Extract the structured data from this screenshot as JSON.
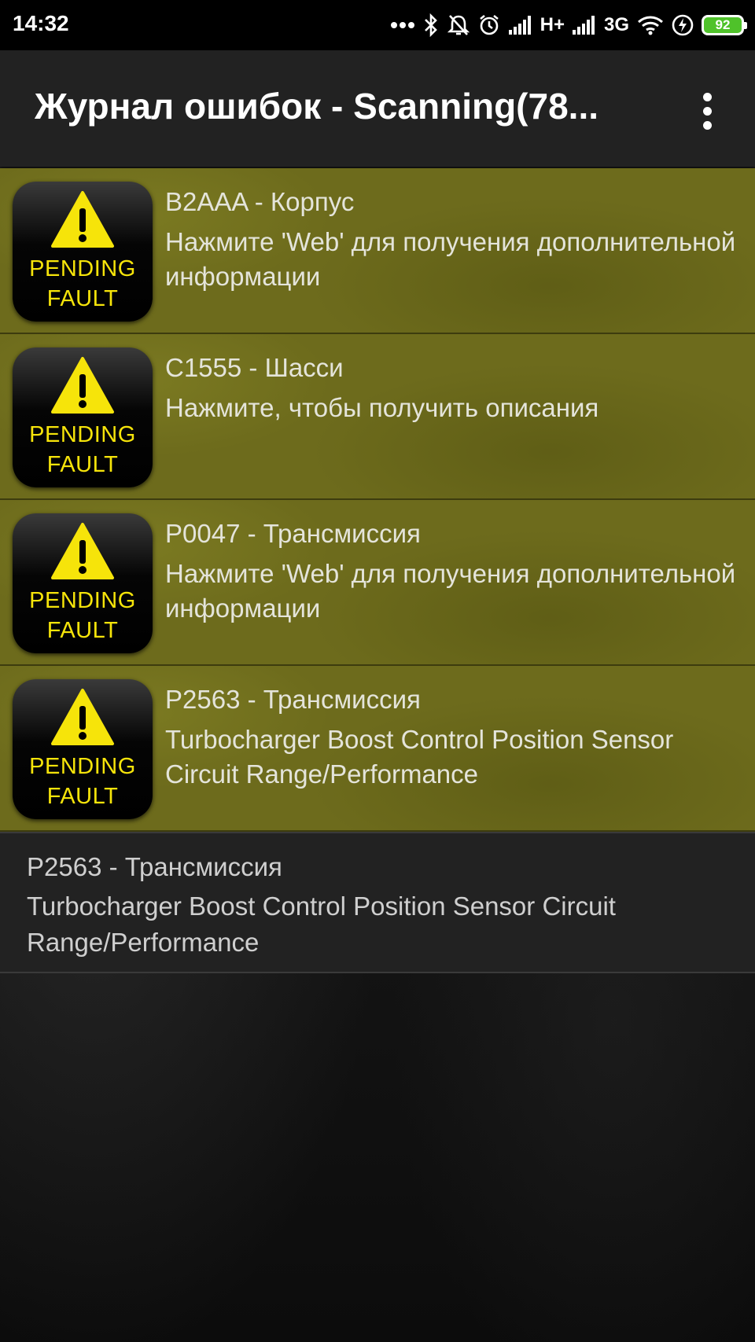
{
  "status_bar": {
    "time": "14:32",
    "network_1": "H+",
    "network_2": "3G",
    "battery": "92",
    "icons": [
      "more-dots-icon",
      "bluetooth-icon",
      "mute-bell-icon",
      "alarm-icon",
      "signal-icon",
      "signal-icon",
      "wifi-icon",
      "charging-icon",
      "battery-icon"
    ]
  },
  "app_bar": {
    "title": "Журнал ошибок - Scanning(78...",
    "menu_icon": "overflow-menu-icon"
  },
  "fault_badge": {
    "line1": "PENDING",
    "line2": "FAULT"
  },
  "faults": [
    {
      "code": "B2AAA - Корпус",
      "description": "Нажмите 'Web' для получения дополнительной информации"
    },
    {
      "code": "C1555 - Шасси",
      "description": "Нажмите, чтобы получить описания"
    },
    {
      "code": "P0047 - Трансмиссия",
      "description": "Нажмите 'Web' для получения дополнительной информации"
    },
    {
      "code": "P2563 - Трансмиссия",
      "description": "Turbocharger Boost Control Position Sensor Circuit Range/Performance"
    }
  ],
  "detail": {
    "code": "P2563 - Трансмиссия",
    "description": "Turbocharger Boost Control Position Sensor Circuit Range/Performance"
  },
  "colors": {
    "row_background": "#6d6b1c",
    "badge_text": "#f6e40a",
    "warning_triangle": "#f6e40a",
    "battery_fill": "#4fc22a"
  }
}
